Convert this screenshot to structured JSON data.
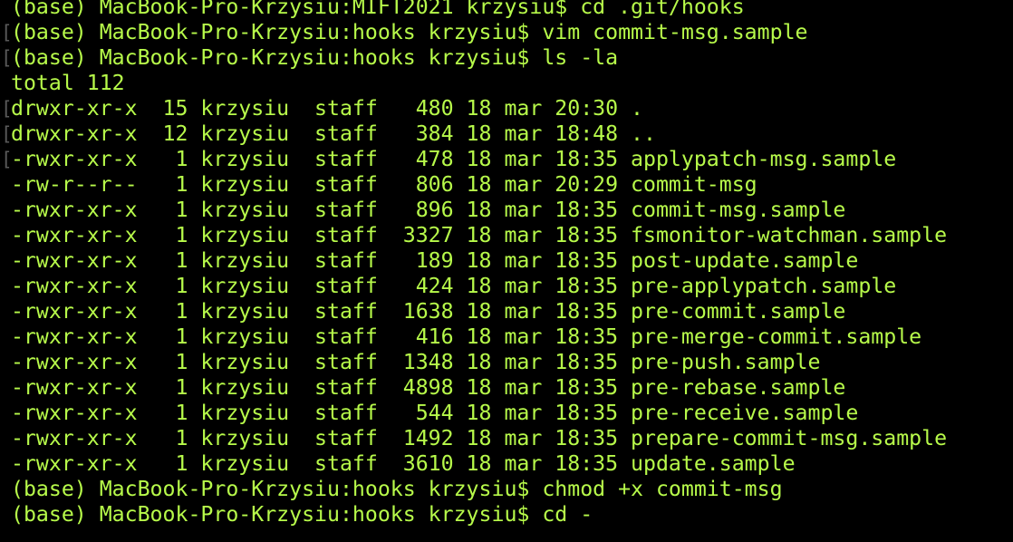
{
  "theme": {
    "background": "#000000",
    "foreground": "#b7fa4a",
    "gutter_mark": "#5a5a5a"
  },
  "gutter_mark_glyph": "[",
  "lines": [
    {
      "text": "(base) MacBook-Pro-Krzysiu:MIFT2021 krzysiu$ cd .git/hooks",
      "marked": false
    },
    {
      "text": "(base) MacBook-Pro-Krzysiu:hooks krzysiu$ vim commit-msg.sample",
      "marked": true
    },
    {
      "text": "(base) MacBook-Pro-Krzysiu:hooks krzysiu$ ls -la",
      "marked": true
    },
    {
      "text": "total 112",
      "marked": false
    },
    {
      "text": "drwxr-xr-x  15 krzysiu  staff   480 18 mar 20:30 .",
      "marked": true
    },
    {
      "text": "drwxr-xr-x  12 krzysiu  staff   384 18 mar 18:48 ..",
      "marked": true
    },
    {
      "text": "-rwxr-xr-x   1 krzysiu  staff   478 18 mar 18:35 applypatch-msg.sample",
      "marked": true
    },
    {
      "text": "-rw-r--r--   1 krzysiu  staff   806 18 mar 20:29 commit-msg",
      "marked": false
    },
    {
      "text": "-rwxr-xr-x   1 krzysiu  staff   896 18 mar 18:35 commit-msg.sample",
      "marked": false
    },
    {
      "text": "-rwxr-xr-x   1 krzysiu  staff  3327 18 mar 18:35 fsmonitor-watchman.sample",
      "marked": false
    },
    {
      "text": "-rwxr-xr-x   1 krzysiu  staff   189 18 mar 18:35 post-update.sample",
      "marked": false
    },
    {
      "text": "-rwxr-xr-x   1 krzysiu  staff   424 18 mar 18:35 pre-applypatch.sample",
      "marked": false
    },
    {
      "text": "-rwxr-xr-x   1 krzysiu  staff  1638 18 mar 18:35 pre-commit.sample",
      "marked": false
    },
    {
      "text": "-rwxr-xr-x   1 krzysiu  staff   416 18 mar 18:35 pre-merge-commit.sample",
      "marked": false
    },
    {
      "text": "-rwxr-xr-x   1 krzysiu  staff  1348 18 mar 18:35 pre-push.sample",
      "marked": false
    },
    {
      "text": "-rwxr-xr-x   1 krzysiu  staff  4898 18 mar 18:35 pre-rebase.sample",
      "marked": false
    },
    {
      "text": "-rwxr-xr-x   1 krzysiu  staff   544 18 mar 18:35 pre-receive.sample",
      "marked": false
    },
    {
      "text": "-rwxr-xr-x   1 krzysiu  staff  1492 18 mar 18:35 prepare-commit-msg.sample",
      "marked": false
    },
    {
      "text": "-rwxr-xr-x   1 krzysiu  staff  3610 18 mar 18:35 update.sample",
      "marked": false
    },
    {
      "text": "(base) MacBook-Pro-Krzysiu:hooks krzysiu$ chmod +x commit-msg",
      "marked": false
    },
    {
      "text": "(base) MacBook-Pro-Krzysiu:hooks krzysiu$ cd -",
      "marked": false
    }
  ]
}
